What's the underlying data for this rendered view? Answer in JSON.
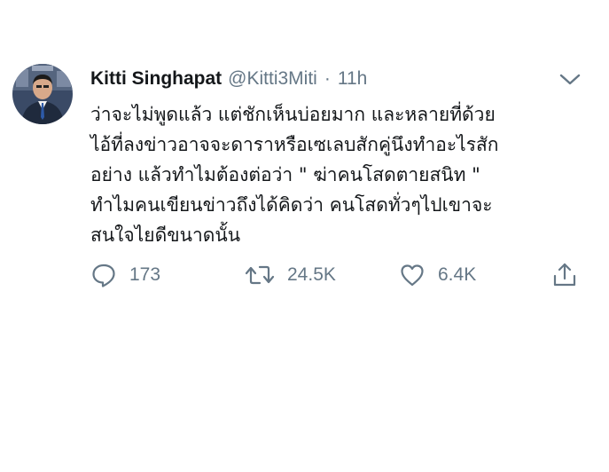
{
  "tweet": {
    "author_name": "Kitti Singhapat",
    "handle": "@Kitti3Miti",
    "separator": "·",
    "time": "11h",
    "body_lines": [
      "ว่าจะไม่พูดแล้ว แต่ชักเห็นบ่อยมาก และหลายที่ด้วย",
      "ไอ้ที่ลงข่าวอาจจะดาราหรือเซเลบสักคู่นึงทำอะไรสัก",
      "อย่าง แล้วทำไมต้องต่อว่า \" ฆ่าคนโสดตายสนิท \"",
      "ทำไมคนเขียนข่าวถึงได้คิดว่า คนโสดทั่วๆไปเขาจะ",
      "สนใจไยดีขนาดนั้น"
    ]
  },
  "actions": {
    "reply_count": "173",
    "retweet_count": "24.5K",
    "like_count": "6.4K"
  },
  "icons": {
    "reply": "speech-bubble-icon",
    "retweet": "retweet-icon",
    "like": "heart-icon",
    "share": "share-upload-icon",
    "menu": "chevron-down-icon"
  },
  "colors": {
    "text": "#14171a",
    "secondary": "#657786"
  }
}
